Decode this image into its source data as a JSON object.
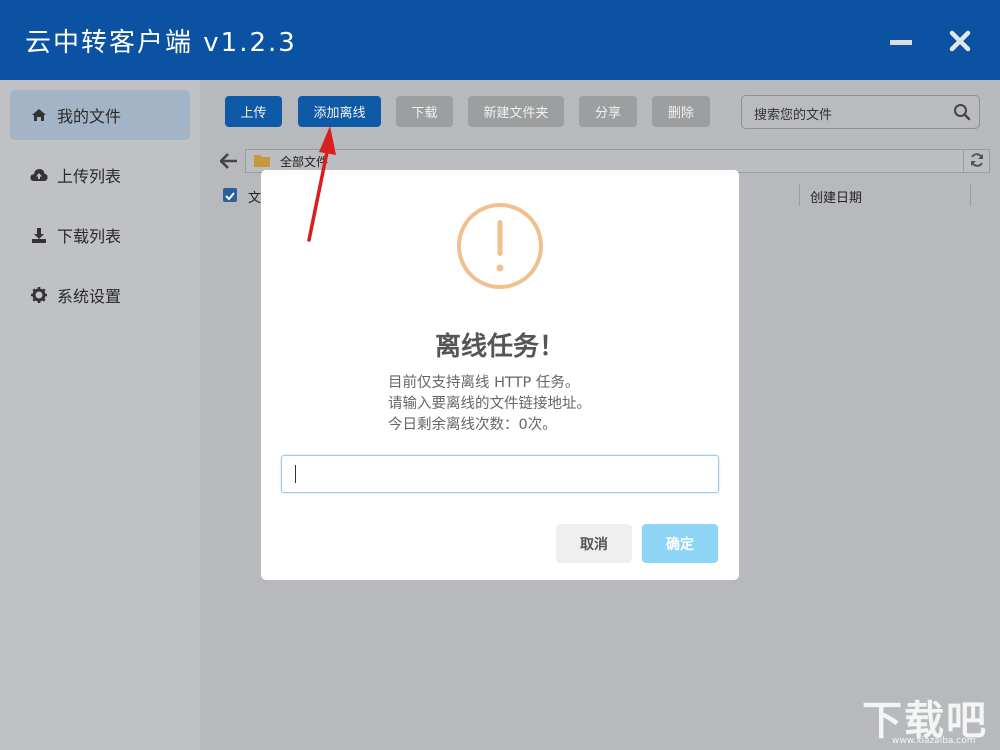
{
  "window": {
    "title": "云中转客户端 v1.2.3",
    "minimize_icon": "minimize-icon",
    "close_icon": "close-icon"
  },
  "sidebar": {
    "items": [
      {
        "label": "我的文件",
        "icon": "home-icon",
        "active": true
      },
      {
        "label": "上传列表",
        "icon": "cloud-upload-icon",
        "active": false
      },
      {
        "label": "下载列表",
        "icon": "download-icon",
        "active": false
      },
      {
        "label": "系统设置",
        "icon": "gear-icon",
        "active": false
      }
    ]
  },
  "toolbar": {
    "buttons": [
      {
        "label": "上传",
        "enabled": true
      },
      {
        "label": "添加离线",
        "enabled": true
      },
      {
        "label": "下载",
        "enabled": false
      },
      {
        "label": "新建文件夹",
        "enabled": false
      },
      {
        "label": "分享",
        "enabled": false
      },
      {
        "label": "删除",
        "enabled": false
      }
    ],
    "search_placeholder": "搜索您的文件"
  },
  "path": {
    "current": "全部文件"
  },
  "file_table": {
    "columns": [
      "文",
      "创建日期"
    ],
    "select_all_checked": true
  },
  "dialog": {
    "icon": "warning-icon",
    "title": "离线任务！",
    "message_lines": [
      "目前仅支持离线 HTTP 任务。",
      "请输入要离线的文件链接地址。",
      "今日剩余离线次数：0次。"
    ],
    "input_value": "",
    "cancel_label": "取消",
    "ok_label": "确定"
  },
  "watermark": {
    "text": "下载吧",
    "url": "www.xiazaiba.com"
  },
  "colors": {
    "titlebar": "#0c52a2",
    "primary_button": "#0f5aa6",
    "disabled_button": "#9c9e9f",
    "ok_button": "#8ed4f5",
    "warning": "#f0c08e",
    "arrow": "#d81e1e"
  }
}
